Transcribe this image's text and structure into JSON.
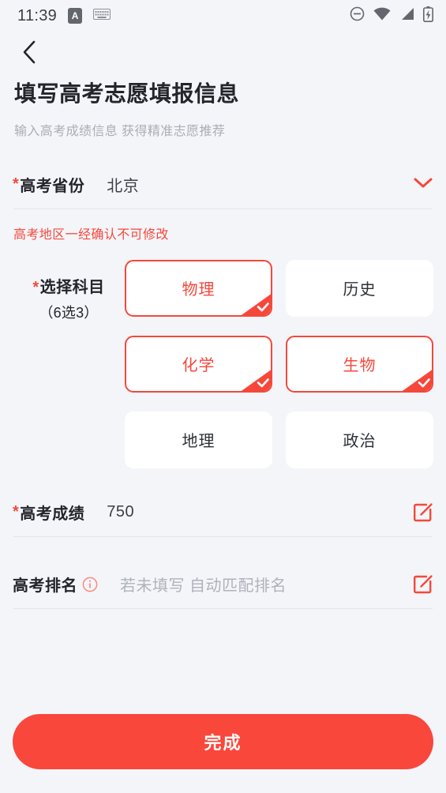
{
  "status_bar": {
    "time": "11:39",
    "ime_badge": "A",
    "icons_left": [
      "ime-badge-icon",
      "keyboard-icon"
    ],
    "icons_right": [
      "do-not-disturb-icon",
      "wifi-icon",
      "cellular-signal-icon",
      "battery-charging-icon"
    ]
  },
  "nav": {
    "back_icon": "chevron-left-icon"
  },
  "header": {
    "title": "填写高考志愿填报信息",
    "subtitle": "输入高考成绩信息 获得精准志愿推荐"
  },
  "province": {
    "required_mark": "*",
    "label": "高考省份",
    "value": "北京",
    "chevron_icon": "chevron-down-icon",
    "hint": "高考地区一经确认不可修改"
  },
  "subjects": {
    "required_mark": "*",
    "label": "选择科目",
    "sub_label": "（6选3）",
    "options": [
      {
        "name": "物理",
        "selected": true
      },
      {
        "name": "历史",
        "selected": false
      },
      {
        "name": "化学",
        "selected": true
      },
      {
        "name": "生物",
        "selected": true
      },
      {
        "name": "地理",
        "selected": false
      },
      {
        "name": "政治",
        "selected": false
      }
    ],
    "check_icon": "check-icon"
  },
  "score": {
    "required_mark": "*",
    "label": "高考成绩",
    "value": "750",
    "edit_icon": "edit-icon"
  },
  "ranking": {
    "required_mark": "",
    "label": "高考排名",
    "info_icon": "info-circle-icon",
    "placeholder": "若未填写 自动匹配排名",
    "value": "",
    "edit_icon": "edit-icon"
  },
  "submit": {
    "label": "完成"
  },
  "colors": {
    "accent_red": "#f5483b",
    "button_red": "#f9473b",
    "page_bg": "#f4f5f9",
    "card_bg": "#ffffff",
    "text_primary": "#22252a",
    "text_secondary": "#a9adb5",
    "divider": "#e3e5ea"
  }
}
